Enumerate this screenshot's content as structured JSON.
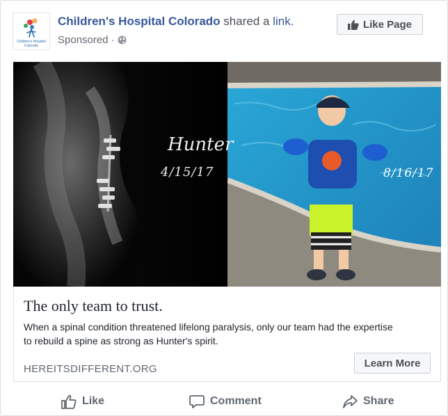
{
  "post": {
    "page_name": "Children's Hospital Colorado",
    "shared_text": "shared a",
    "link_word": "link.",
    "sponsored": "Sponsored",
    "dot": "·",
    "like_page_label": "Like Page",
    "avatar_line1": "Children's Hospital",
    "avatar_line2": "Colorado"
  },
  "media": {
    "title": "Hunter",
    "date_left": "4/15/17",
    "date_right": "8/16/17"
  },
  "link": {
    "headline": "The only team to trust.",
    "description": "When a spinal condition threatened lifelong paralysis, only our team had the expertise to rebuild a spine as strong as Hunter's spirit.",
    "domain": "HEREITSDIFFERENT.ORG",
    "cta_label": "Learn More"
  },
  "actions": {
    "like": "Like",
    "comment": "Comment",
    "share": "Share"
  },
  "colors": {
    "brand_link": "#365899",
    "text_dark": "#1d2129",
    "text_muted": "#606770",
    "border": "#dddfe2",
    "button_bg": "#f6f7f9"
  },
  "icons": {
    "globe": "globe-icon",
    "thumbs_up": "thumbs-up-icon",
    "comment": "comment-icon",
    "share": "share-icon"
  }
}
